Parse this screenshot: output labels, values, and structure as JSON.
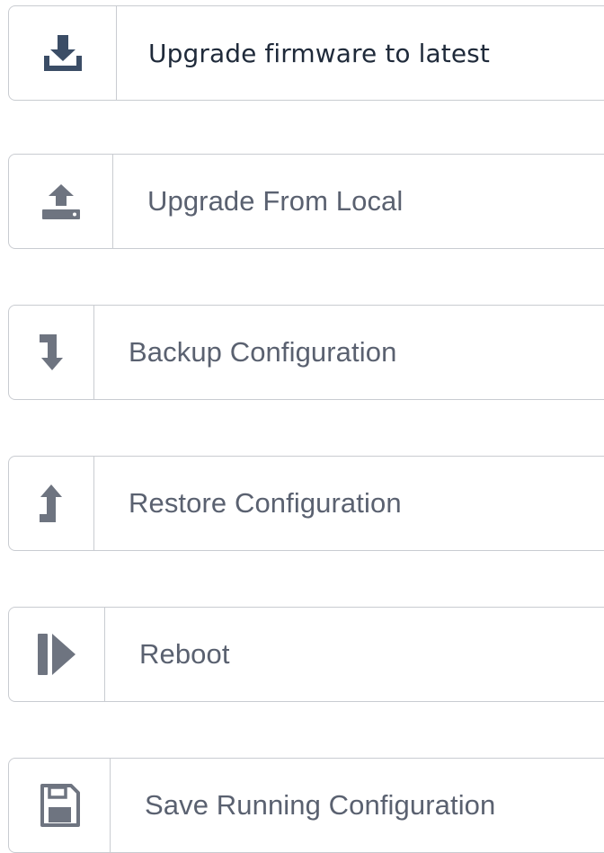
{
  "actions": [
    {
      "label": "Upgrade firmware to latest",
      "icon": "download-tray-icon"
    },
    {
      "label": "Upgrade From Local",
      "icon": "upload-tray-icon"
    },
    {
      "label": "Backup Configuration",
      "icon": "backup-arrow-down-icon"
    },
    {
      "label": "Restore Configuration",
      "icon": "restore-arrow-up-icon"
    },
    {
      "label": "Reboot",
      "icon": "reboot-play-icon"
    },
    {
      "label": "Save Running Configuration",
      "icon": "floppy-disk-icon"
    }
  ],
  "colors": {
    "icon_primary": "#3b4d66",
    "icon_secondary": "#6e7480",
    "text_primary": "#1f2a3a",
    "text_secondary": "#5a6170",
    "border": "#c9ccd1"
  }
}
